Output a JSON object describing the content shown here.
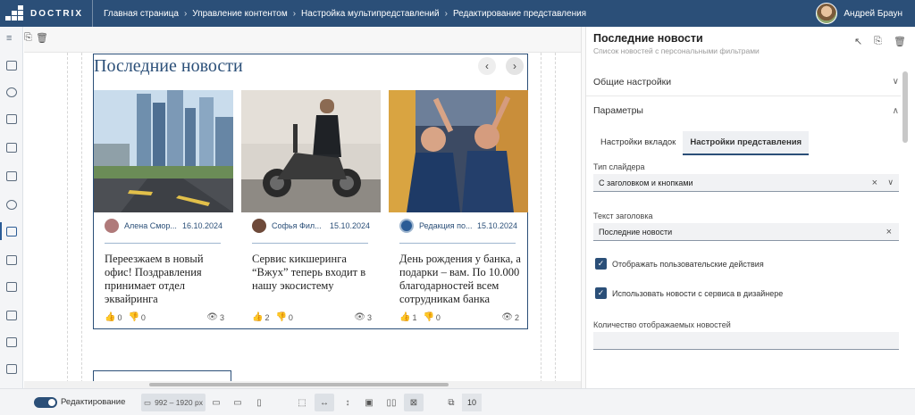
{
  "app": {
    "brand": "DOCTRIX"
  },
  "breadcrumbs": [
    "Главная страница",
    "Управление контентом",
    "Настройка мультипредставлений",
    "Редактирование представления"
  ],
  "user": {
    "name": "Андрей Браун"
  },
  "widget": {
    "title": "Последние новости",
    "cards": [
      {
        "author": "Алена Смор...",
        "date": "16.10.2024",
        "title": "Переезжаем в новый офис! Поздравления принимает отдел эквайринга",
        "likes": "0",
        "dislikes": "0",
        "views": "3"
      },
      {
        "author": "Софья Фил...",
        "date": "15.10.2024",
        "title": "Сервис кикшеринга “Вжух” теперь входит в нашу экосистему",
        "likes": "2",
        "dislikes": "0",
        "views": "3"
      },
      {
        "author": "Редакция по...",
        "date": "15.10.2024",
        "title": "День рождения у банка, а подарки – вам. По 10.000 благодарностей всем сотрудникам банка",
        "likes": "1",
        "dislikes": "0",
        "views": "2"
      }
    ]
  },
  "panel": {
    "title": "Последние новости",
    "subtitle": "Список новостей с персональными фильтрами",
    "sections": {
      "general": "Общие настройки",
      "params": "Параметры"
    },
    "tabs": [
      "Настройки вкладок",
      "Настройки представления"
    ],
    "slider_type": {
      "label": "Тип слайдера",
      "value": "С заголовком и кнопками"
    },
    "header_text": {
      "label": "Текст заголовка",
      "value": "Последние новости"
    },
    "checkboxes": [
      "Отображать пользовательские действия",
      "Использовать новости с сервиса в дизайнере"
    ],
    "count_label": "Количество отображаемых новостей"
  },
  "bottombar": {
    "edit_label": "Редактирование",
    "resolution": "992 – 1920 px",
    "zoom": "10"
  }
}
